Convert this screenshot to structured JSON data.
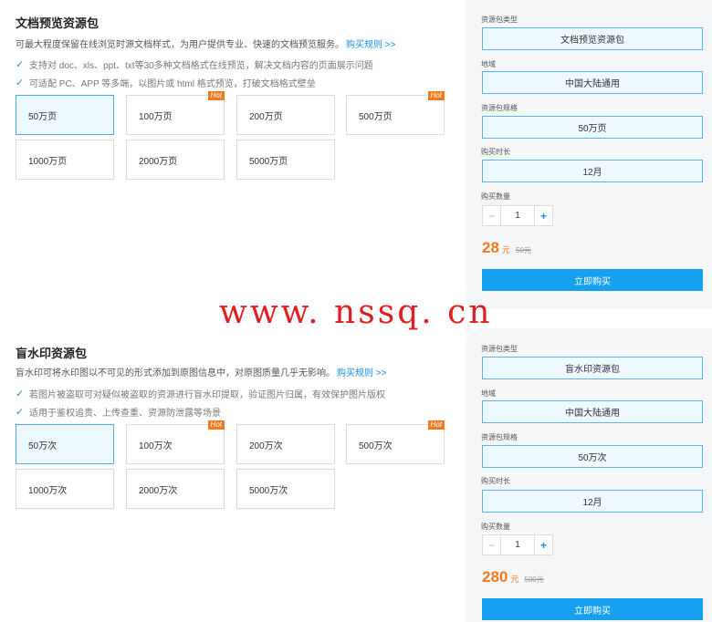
{
  "sections": [
    {
      "title": "文档预览资源包",
      "desc": "可最大程度保留在线浏览时源文档样式，为用户提供专业、快速的文档预览服务。",
      "link": "购买规则 >>",
      "features": [
        "支持对 doc、xls、ppt、txt等30多种文档格式在线预览，解决文档内容的页面展示问题",
        "可适配 PC、APP 等多端，以图片或 html 格式预览，打破文档格式壁垒"
      ],
      "options": [
        "50万页",
        "100万页",
        "200万页",
        "500万页",
        "1000万页",
        "2000万页",
        "5000万页"
      ],
      "hot_badge": "Hot",
      "sidebar": {
        "type_label": "资源包类型",
        "type_value": "文档预览资源包",
        "region_label": "地域",
        "region_value": "中国大陆通用",
        "spec_label": "资源包规格",
        "spec_value": "50万页",
        "duration_label": "购买时长",
        "duration_value": "12月",
        "qty_label": "购买数量",
        "qty_minus": "−",
        "qty_value": "1",
        "qty_plus": "+",
        "price": "28",
        "price_unit": "元",
        "old_price": "50元",
        "buy_label": "立即购买"
      }
    },
    {
      "title": "盲水印资源包",
      "desc": "盲水印可将水印图以不可见的形式添加到原图信息中，对原图质量几乎无影响。",
      "link": "购买规则 >>",
      "features": [
        "若图片被盗取可对疑似被盗取的资源进行盲水印提取，验证图片归属，有效保护图片版权",
        "适用于鉴权追责、上传查重、资源防泄露等场景"
      ],
      "options": [
        "50万次",
        "100万次",
        "200万次",
        "500万次",
        "1000万次",
        "2000万次",
        "5000万次"
      ],
      "hot_badge": "Hot",
      "sidebar": {
        "type_label": "资源包类型",
        "type_value": "盲水印资源包",
        "region_label": "地域",
        "region_value": "中国大陆通用",
        "spec_label": "资源包规格",
        "spec_value": "50万次",
        "duration_label": "购买时长",
        "duration_value": "12月",
        "qty_label": "购买数量",
        "qty_minus": "−",
        "qty_value": "1",
        "qty_plus": "+",
        "price": "280",
        "price_unit": "元",
        "old_price": "500元",
        "buy_label": "立即购买"
      }
    }
  ],
  "watermark": "www. nssq. cn",
  "icons": {
    "check": "check-icon"
  },
  "colors": {
    "accent": "#1e8ce6",
    "price": "#f07a1c",
    "hot": "#f07a1c",
    "button": "#18a0f0"
  }
}
